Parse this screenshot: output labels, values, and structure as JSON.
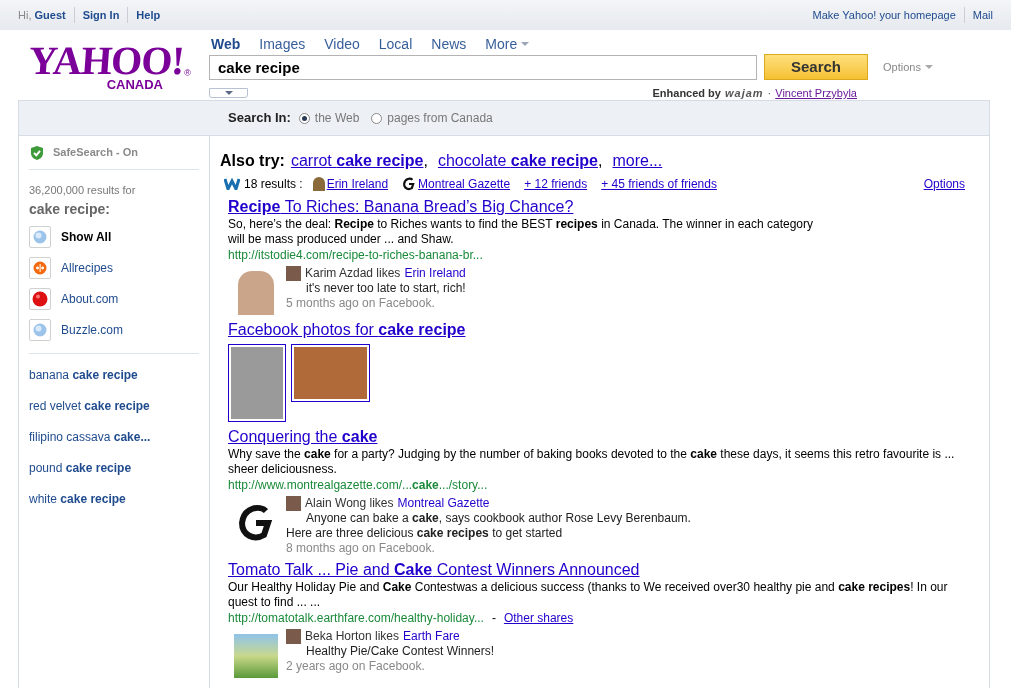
{
  "top_bar": {
    "left_links": [
      "Hi, **Guest**",
      "Sign In",
      "Help"
    ],
    "right_links": [
      "Make Yahoo! your homepage",
      "Mail"
    ]
  },
  "logo": {
    "wordmark": "YAHOO!",
    "mark": "®",
    "region": "CANADA"
  },
  "tabs": [
    {
      "label": "Web",
      "selected": true,
      "caret": false
    },
    {
      "label": "Images",
      "selected": false,
      "caret": false
    },
    {
      "label": "Video",
      "selected": false,
      "caret": false
    },
    {
      "label": "Local",
      "selected": false,
      "caret": false
    },
    {
      "label": "News",
      "selected": false,
      "caret": false
    },
    {
      "label": "More",
      "selected": false,
      "caret": true
    }
  ],
  "search": {
    "value": "cake recipe",
    "button": "Search",
    "options": "Options"
  },
  "enhanced": {
    "label": "Enhanced by",
    "brand": "wajam",
    "separator": "·",
    "user": "Vincent Przybyla"
  },
  "search_in": {
    "label": "Search In:",
    "options": [
      {
        "label": "the Web",
        "selected": true
      },
      {
        "label": "pages from Canada",
        "selected": false
      }
    ]
  },
  "sidebar": {
    "safesearch": "SafeSearch - On",
    "results_count": "36,200,000 results for",
    "query": "cake recipe:",
    "sources": [
      {
        "label": "Show All",
        "kind": "globe",
        "selected": true
      },
      {
        "label": "Allrecipes",
        "kind": "allrecipes",
        "selected": false
      },
      {
        "label": "About.com",
        "kind": "ball",
        "selected": false
      },
      {
        "label": "Buzzle.com",
        "kind": "globe",
        "selected": false
      }
    ],
    "related": [
      "banana **cake recipe**",
      "red velvet **cake recipe**",
      "filipino cassava **cake...**",
      "pound **cake recipe**",
      "white **cake recipe**"
    ]
  },
  "also_try": {
    "label": "Also try:",
    "links": [
      {
        "text": "carrot **cake recipe**",
        "trailing": ","
      },
      {
        "text": "chocolate **cake recipe**",
        "trailing": ","
      },
      {
        "text": "more..."
      }
    ]
  },
  "wajam_bar": {
    "count": "18 results :",
    "friends": [
      {
        "text": "Erin Ireland",
        "kind": "person"
      },
      {
        "text": "Montreal Gazette",
        "kind": "gazette"
      },
      {
        "text": "+ 12 friends",
        "kind": "plain"
      },
      {
        "text": "+ 45 friends of friends",
        "kind": "plain"
      }
    ],
    "options": "Options"
  },
  "results": [
    {
      "kind": "web",
      "title": "**Recipe** To Riches: Banana Bread’s Big Chance?",
      "snippet": "So, here’s the deal: **Recipe** to Riches wants to find the BEST **recipes** in Canada. The winner in each category will be mass produced under ... and Shaw.",
      "url": "http://itstodie4.com/recipe-to-riches-banana-br...",
      "social": {
        "kind": "person",
        "liker": "Karim Azdad likes",
        "page": "Erin Ireland",
        "messages": [
          "it's never too late to start, rich!"
        ],
        "time": "5 months ago on Facebook."
      }
    },
    {
      "kind": "photos",
      "title": "Facebook photos for **cake recipe**",
      "photos": [
        {
          "kind": "portrait"
        },
        {
          "kind": "food"
        }
      ]
    },
    {
      "kind": "web",
      "title": "Conquering the **cake**",
      "snippet": "Why save the **cake** for a party? Judging by the number of baking books devoted to the **cake** these days, it seems this retro favourite is ... sheer deliciousness.",
      "url": "http://www.montrealgazette.com/...**cake**.../story...",
      "social": {
        "kind": "gazette",
        "liker": "Alain Wong likes",
        "page": "Montreal Gazette",
        "messages": [
          "Anyone can bake a **cake**, says cookbook author Rose Levy Berenbaum.",
          "Here are three delicious **cake recipes** to get started"
        ],
        "time": "8 months ago on Facebook."
      }
    },
    {
      "kind": "web",
      "title": "Tomato Talk ... Pie and **Cake** Contest Winners Announced",
      "snippet": "Our Healthy Holiday Pie and **Cake** Contestwas a delicious success (thanks to We received over30 healthy pie and **cake recipes**! In our quest to find ... ...",
      "url": "http://tomatotalk.earthfare.com/healthy-holiday...",
      "separator": "-",
      "other_shares": "Other shares",
      "social": {
        "kind": "banner",
        "liker": "Beka Horton likes",
        "page": "Earth Fare",
        "messages": [
          "Healthy Pie/Cake Contest Winners!"
        ],
        "time": "2 years ago on Facebook."
      }
    }
  ]
}
